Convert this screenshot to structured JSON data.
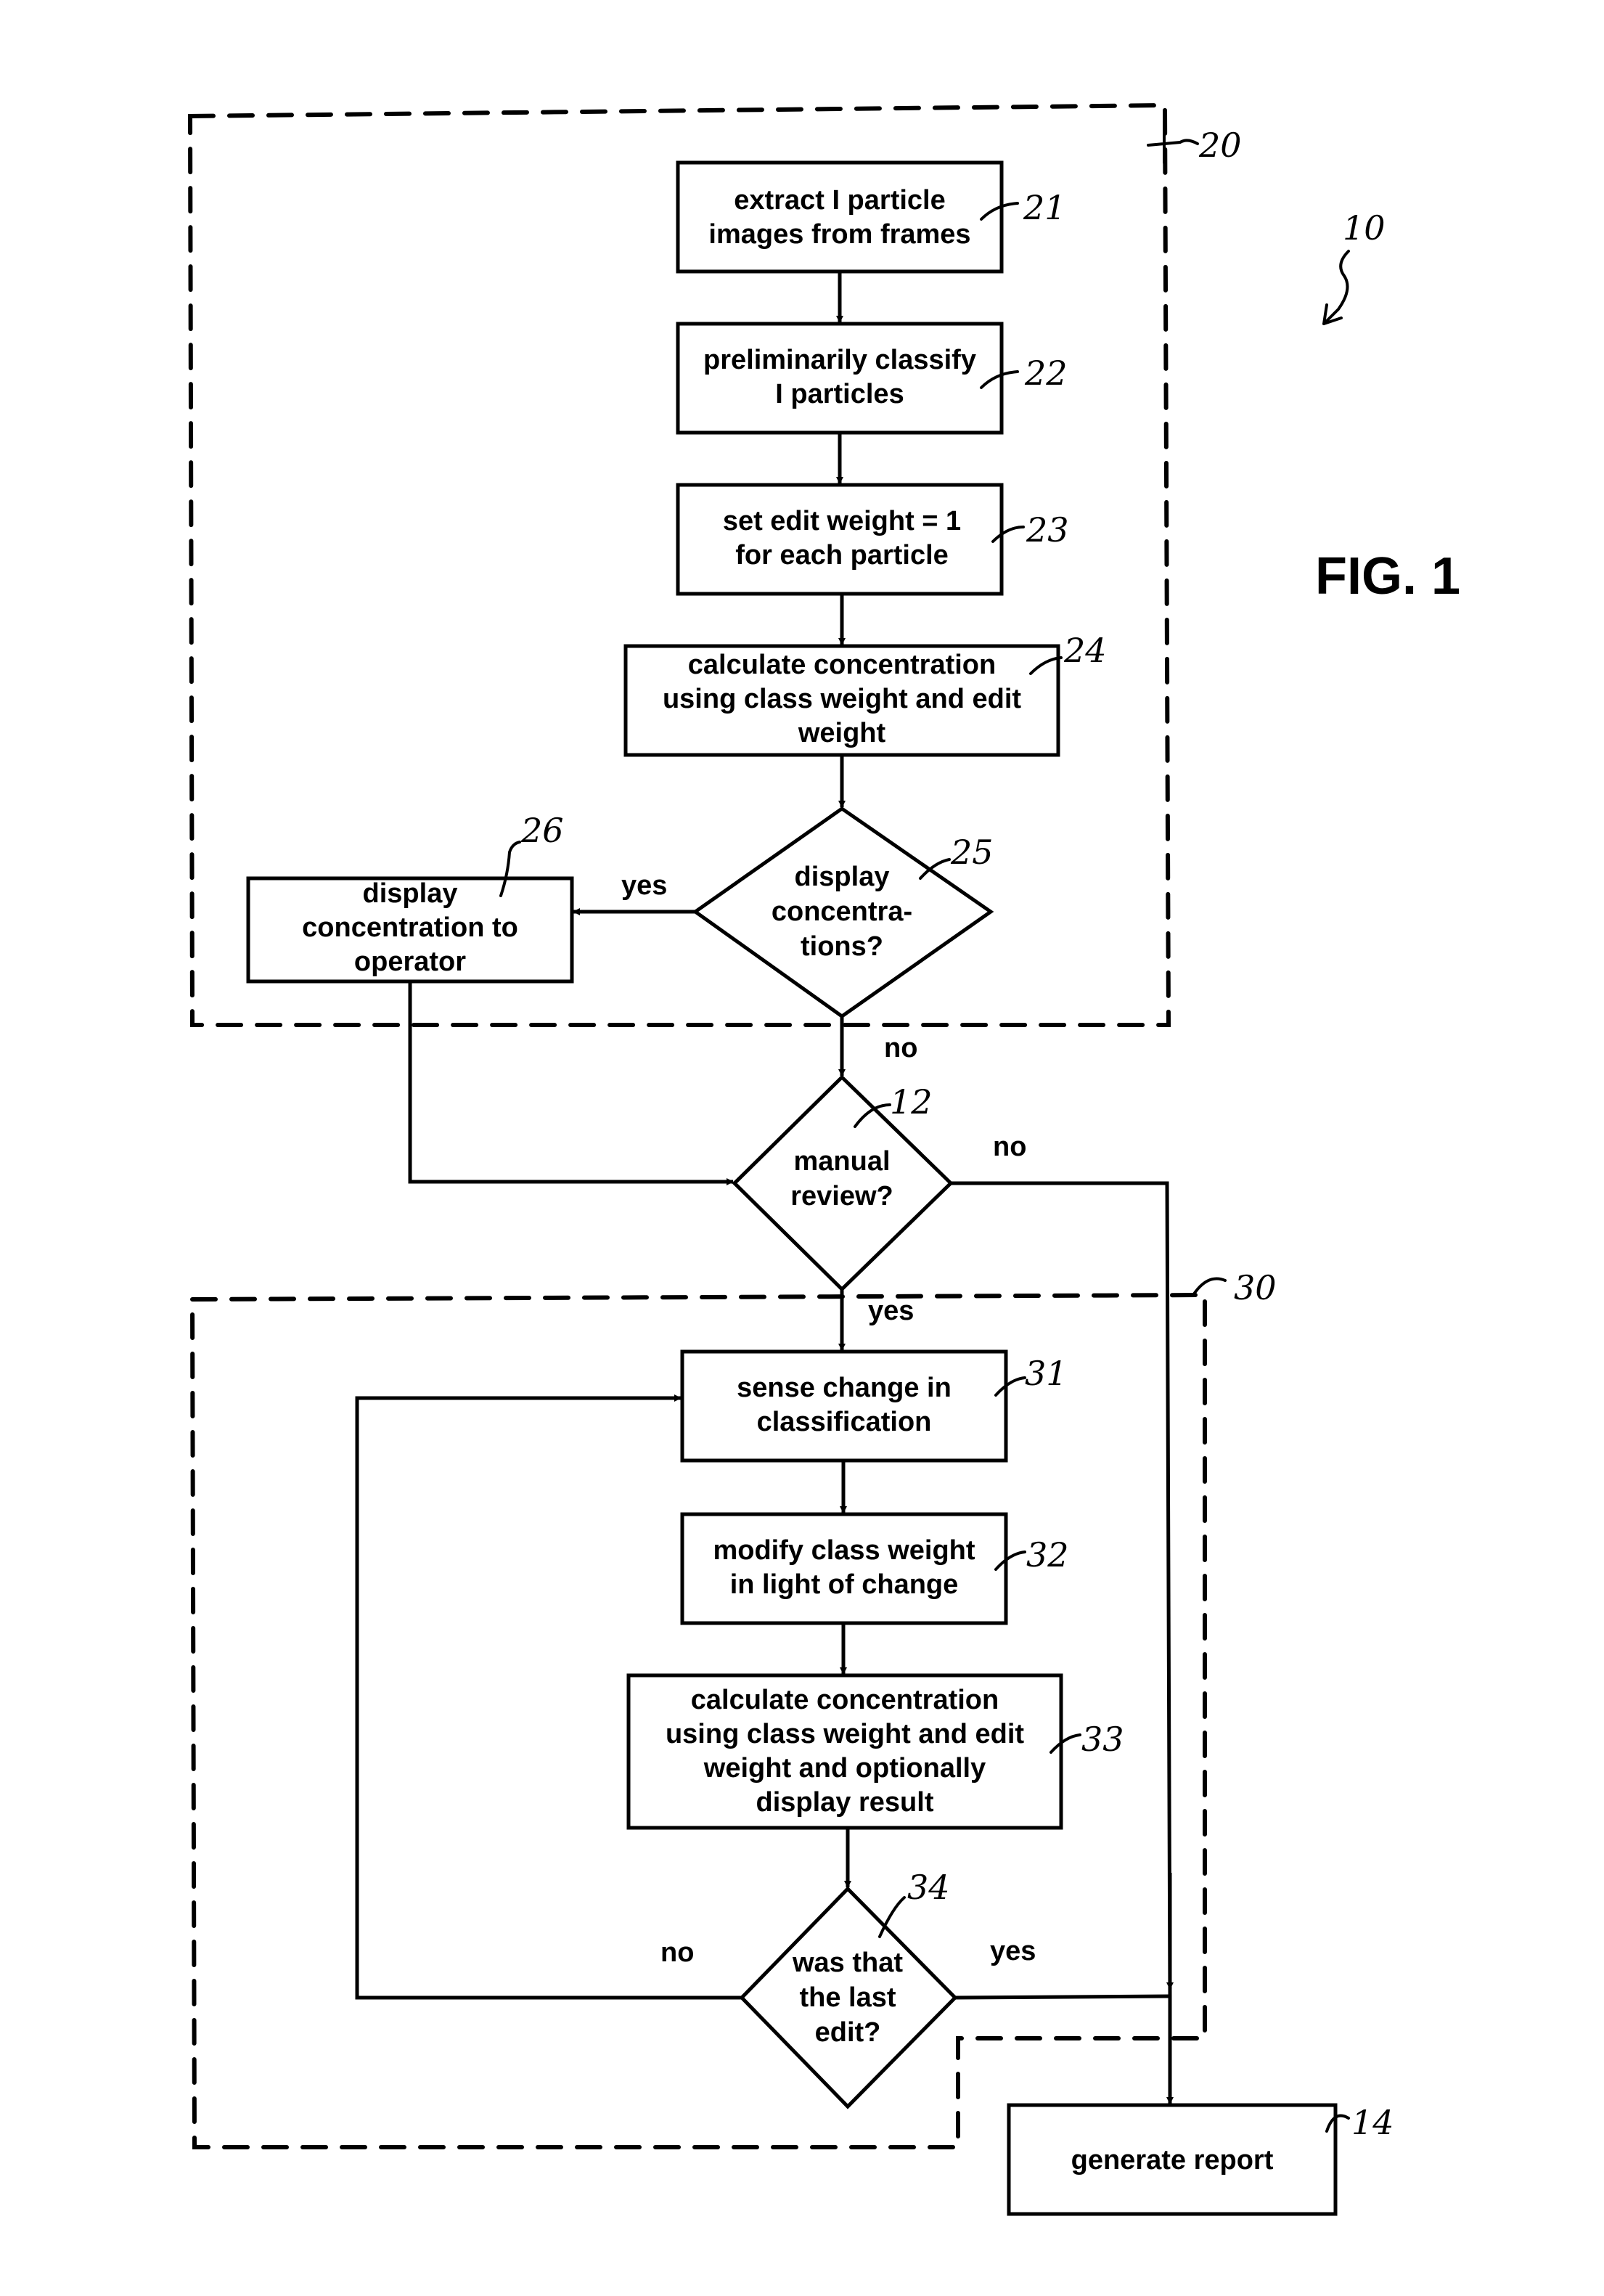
{
  "figure": {
    "title": "FIG. 1",
    "ref_system": "10",
    "groups": [
      {
        "id": "stage-20",
        "ref": "20"
      },
      {
        "id": "stage-30",
        "ref": "30"
      }
    ],
    "nodes": {
      "n21": {
        "ref": "21",
        "type": "process",
        "lines": [
          "extract I particle",
          "images from frames"
        ]
      },
      "n22": {
        "ref": "22",
        "type": "process",
        "lines": [
          "preliminarily classify",
          "I particles"
        ]
      },
      "n23": {
        "ref": "23",
        "type": "process",
        "lines": [
          "set edit weight = 1",
          "for each particle"
        ]
      },
      "n24": {
        "ref": "24",
        "type": "process",
        "lines": [
          "calculate concentration",
          "using class weight and edit",
          "weight"
        ]
      },
      "n25": {
        "ref": "25",
        "type": "decision",
        "lines": [
          "display",
          "concentra-",
          "tions?"
        ]
      },
      "n26": {
        "ref": "26",
        "type": "process",
        "lines": [
          "display",
          "concentration to",
          "operator"
        ]
      },
      "n12": {
        "ref": "12",
        "type": "decision",
        "lines": [
          "manual",
          "review?"
        ]
      },
      "n31": {
        "ref": "31",
        "type": "process",
        "lines": [
          "sense change in",
          "classification"
        ]
      },
      "n32": {
        "ref": "32",
        "type": "process",
        "lines": [
          "modify class weight",
          "in light of change"
        ]
      },
      "n33": {
        "ref": "33",
        "type": "process",
        "lines": [
          "calculate concentration",
          "using class weight and edit",
          "weight and optionally",
          "display result"
        ]
      },
      "n34": {
        "ref": "34",
        "type": "decision",
        "lines": [
          "was that",
          "the last",
          "edit?"
        ]
      },
      "n14": {
        "ref": "14",
        "type": "process",
        "lines": [
          "generate report"
        ]
      }
    },
    "edge_labels": {
      "e25_yes": "yes",
      "e25_no": "no",
      "e12_no": "no",
      "e12_yes": "yes",
      "e34_no": "no",
      "e34_yes": "yes"
    }
  }
}
